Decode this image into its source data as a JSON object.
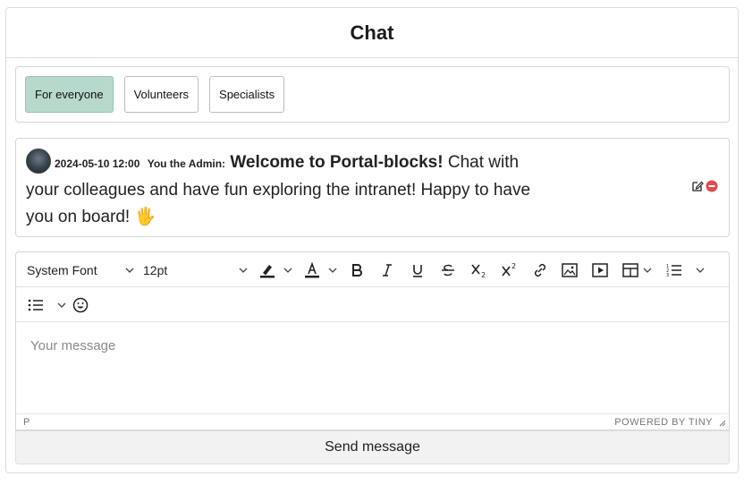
{
  "chat": {
    "title": "Chat"
  },
  "tabs": [
    {
      "label": "For everyone",
      "active": true
    },
    {
      "label": "Volunteers",
      "active": false
    },
    {
      "label": "Specialists",
      "active": false
    }
  ],
  "colors": {
    "active_tab": "#b6d9cc",
    "delete_icon": "#e04b4b"
  },
  "message": {
    "timestamp": "2024-05-10 12:00",
    "author": "You the Admin:",
    "bold_text": "Welcome to Portal-blocks!",
    "text": " Chat with your colleagues and have fun exploring the intranet! Happy to have you on board! ",
    "emoji": "🖐"
  },
  "editor": {
    "font_family": "System Font",
    "font_size": "12pt",
    "placeholder": "Your message",
    "status_path": "P",
    "powered_by": "POWERED BY TINY"
  },
  "send": {
    "label": "Send message"
  },
  "icons": [
    "edit-icon",
    "delete-icon",
    "highlight-icon",
    "text-color-icon",
    "bold-icon",
    "italic-icon",
    "underline-icon",
    "strikethrough-icon",
    "subscript-icon",
    "superscript-icon",
    "link-icon",
    "image-icon",
    "media-icon",
    "table-icon",
    "numbered-list-icon",
    "bullet-list-icon",
    "emoji-icon",
    "resize-handle-icon"
  ]
}
